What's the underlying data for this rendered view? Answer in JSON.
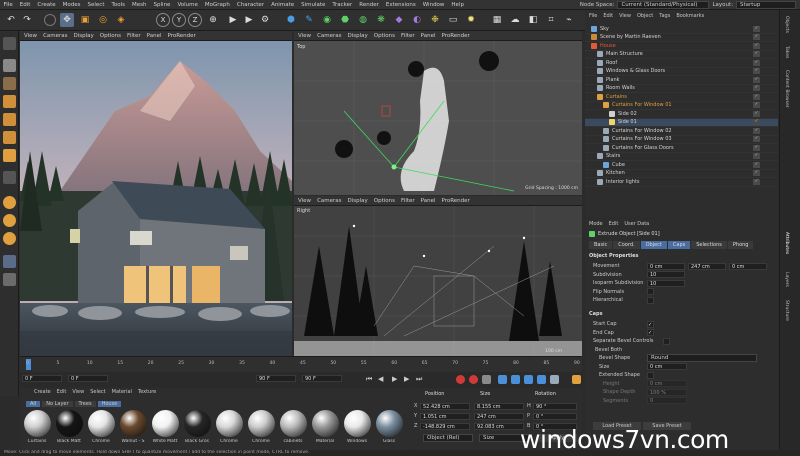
{
  "menu": [
    "File",
    "Edit",
    "Create",
    "Modes",
    "Select",
    "Tools",
    "Mesh",
    "Spline",
    "Volume",
    "MoGraph",
    "Character",
    "Animate",
    "Simulate",
    "Tracker",
    "Render",
    "Extensions",
    "Window",
    "Help"
  ],
  "node_space_label": "Node Space:",
  "node_space_value": "Current (Standard/Physical)",
  "layout_label": "Layout:",
  "layout_value": "Startup",
  "toolbar": {
    "x": "X",
    "y": "Y",
    "z": "Z"
  },
  "viewport_menu": [
    "View",
    "Cameras",
    "Display",
    "Options",
    "Filter",
    "Panel",
    "ProRender"
  ],
  "top_view_label": "Top",
  "right_view_label": "Right",
  "grid_spacing_top": "Grid Spacing : 1000 cm",
  "grid_spacing_right": "100 cm",
  "timeline": {
    "ticks": [
      "0",
      "5",
      "10",
      "15",
      "20",
      "25",
      "30",
      "35",
      "40",
      "45",
      "50",
      "55",
      "60",
      "65",
      "70",
      "75",
      "80",
      "85",
      "90"
    ]
  },
  "transport": {
    "start": "0 F",
    "current": "0 F",
    "end": "90 F",
    "end2": "90 F",
    "frame_badge": "0 F"
  },
  "material_manager": {
    "menu": [
      "Create",
      "Edit",
      "View",
      "Select",
      "Material",
      "Texture"
    ],
    "filters": [
      "All",
      "No Layer",
      "Trees",
      "House"
    ],
    "materials": [
      {
        "name": "Curtains",
        "color": "#cfcfcf"
      },
      {
        "name": "Black Matt",
        "color": "#151515"
      },
      {
        "name": "Chrome",
        "color": "#e6e6e6"
      },
      {
        "name": "Walnut - S",
        "color": "#6b4a2e"
      },
      {
        "name": "White Matt",
        "color": "#f2f2f2"
      },
      {
        "name": "Black Gros",
        "color": "#262626"
      },
      {
        "name": "Chrome",
        "color": "#d8d8d8"
      },
      {
        "name": "Chrome",
        "color": "#cdcdcd"
      },
      {
        "name": "cabinets",
        "color": "#bdbdbd"
      },
      {
        "name": "Material",
        "color": "#9a9a9a"
      },
      {
        "name": "Windows",
        "color": "#e9e9e9"
      },
      {
        "name": "Glass",
        "color": "#7c8fa0"
      }
    ]
  },
  "coordinates": {
    "headers": [
      "Position",
      "Size",
      "Rotation"
    ],
    "rows": [
      {
        "axis": "X",
        "pos": "52.428 cm",
        "size": "8.155 cm",
        "rot_axis": "H",
        "rot": "90 °"
      },
      {
        "axis": "Y",
        "pos": "1.051 cm",
        "size": "247 cm",
        "rot_axis": "P",
        "rot": "0 °"
      },
      {
        "axis": "Z",
        "pos": "-148.829 cm",
        "size": "92.083 cm",
        "rot_axis": "B",
        "rot": "0 °"
      }
    ],
    "mode_select": "Object (Rel)",
    "size_select": "Size",
    "apply": "Apply"
  },
  "object_manager": {
    "menu": [
      "File",
      "Edit",
      "View",
      "Object",
      "Tags",
      "Bookmarks"
    ],
    "items": [
      {
        "name": "Sky",
        "indent": 0,
        "color": "#6aa6d9"
      },
      {
        "name": "Scene by Martin Raeven",
        "indent": 0,
        "color": "#c98a3c"
      },
      {
        "name": "House",
        "indent": 0,
        "color": "#e05a3a"
      },
      {
        "name": "Main Structure",
        "indent": 1,
        "color": "#9aa9b5"
      },
      {
        "name": "Roof",
        "indent": 1,
        "color": "#9aa9b5"
      },
      {
        "name": "Windows & Glass Doors",
        "indent": 1,
        "color": "#9aa9b5"
      },
      {
        "name": "Plank",
        "indent": 1,
        "color": "#9aa9b5"
      },
      {
        "name": "Room Walls",
        "indent": 1,
        "color": "#9aa9b5"
      },
      {
        "name": "Curtains",
        "indent": 1,
        "color": "#e0a040"
      },
      {
        "name": "Curtains For Window 01",
        "indent": 2,
        "color": "#e0a040"
      },
      {
        "name": "Side 02",
        "indent": 3,
        "color": "#cfcfcf"
      },
      {
        "name": "Side 01",
        "indent": 3,
        "color": "#f1d36b"
      },
      {
        "name": "Curtains For Window 02",
        "indent": 2,
        "color": "#9aa9b5"
      },
      {
        "name": "Curtains For Window 03",
        "indent": 2,
        "color": "#9aa9b5"
      },
      {
        "name": "Curtains For Glass Doors",
        "indent": 2,
        "color": "#9aa9b5"
      },
      {
        "name": "Stairs",
        "indent": 1,
        "color": "#9aa9b5"
      },
      {
        "name": "Cube",
        "indent": 2,
        "color": "#6aa6d9"
      },
      {
        "name": "Kitchen",
        "indent": 1,
        "color": "#9aa9b5"
      },
      {
        "name": "Interior lights",
        "indent": 1,
        "color": "#9aa9b5"
      }
    ]
  },
  "attributes": {
    "menu": [
      "Mode",
      "Edit",
      "User Data"
    ],
    "object_title": "Extrude Object [Side 01]",
    "tabs": [
      "Basic",
      "Coord.",
      "Object",
      "Caps",
      "Selections",
      "Phong"
    ],
    "active_tabs": [
      "Object",
      "Caps"
    ],
    "section_object": "Object Properties",
    "movement_label": "Movement",
    "movement_values": [
      "0 cm",
      "247 cm",
      "0 cm"
    ],
    "subdivision_label": "Subdivision",
    "subdivision_value": "10",
    "isoparm_label": "Isoparm Subdivision",
    "isoparm_value": "10",
    "flip_normals": "Flip Normals",
    "hierarchical": "Hierarchical",
    "section_caps": "Caps",
    "start_cap": "Start Cap",
    "end_cap": "End Cap",
    "separate_bevel": "Separate Bevel Controls",
    "bevel_both": "Bevel Both",
    "bevel_shape_label": "Bevel Shape",
    "bevel_shape_value": "Round",
    "size_label": "Size",
    "size_value": "0 cm",
    "extended_shape": "Extended Shape",
    "height_label": "Height",
    "height_value": "0 cm",
    "shape_depth_label": "Shape Depth",
    "shape_depth_value": "100 %",
    "segments_label": "Segments",
    "segments_value": "0",
    "load_preset": "Load Preset",
    "save_preset": "Save Preset"
  },
  "side_tabs": [
    "Attributes",
    "Layers",
    "Structure"
  ],
  "right_edge_tabs": [
    "Objects",
    "Takes",
    "Content Browser"
  ],
  "status": "Move: Click and drag to move elements. Hold down SHIFT to quantize movement / add to the selection in point mode, CTRL to remove.",
  "watermark": "windows7vn.com"
}
